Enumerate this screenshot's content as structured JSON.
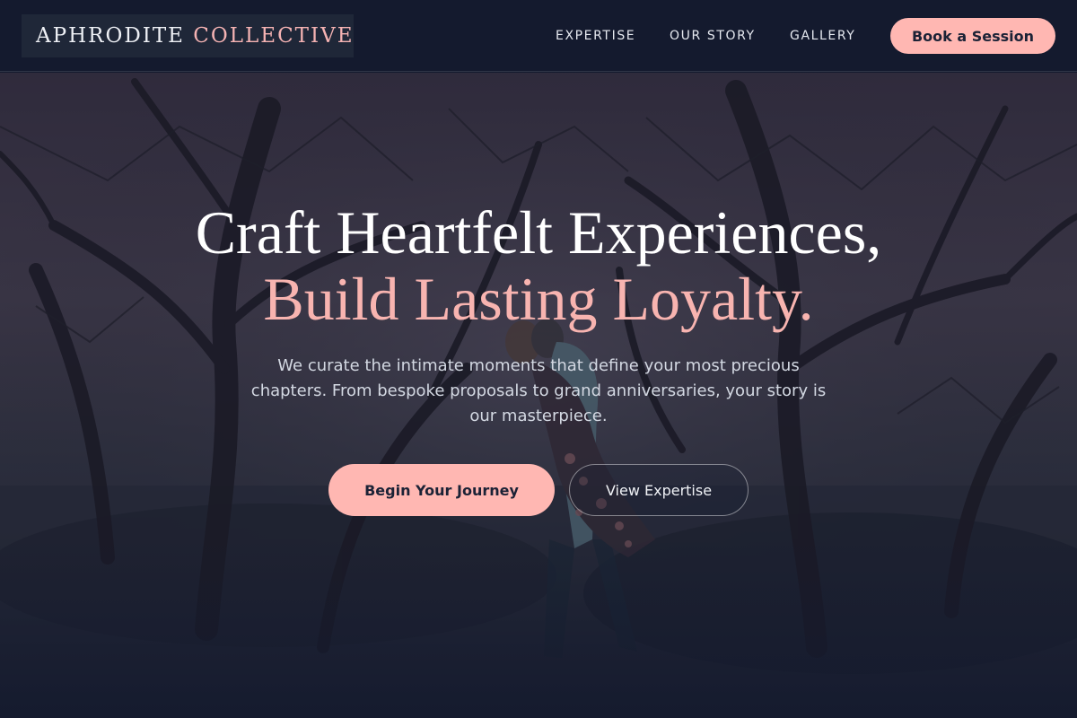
{
  "brand": {
    "name_part1": "APHRODITE",
    "name_part2": "COLLECTIVE"
  },
  "nav": {
    "links": [
      {
        "label": "EXPERTISE"
      },
      {
        "label": "OUR STORY"
      },
      {
        "label": "GALLERY"
      }
    ],
    "cta_label": "Book a Session"
  },
  "hero": {
    "headline_line1": "Craft Heartfelt Experiences,",
    "headline_line2": "Build Lasting Loyalty.",
    "subtext": "We curate the intimate moments that define your most precious chapters. From bespoke proposals to grand anniversaries, your story is our masterpiece.",
    "primary_button": "Begin Your Journey",
    "secondary_button": "View Expertise",
    "background_image": "couple-kissing-under-trees-photo"
  },
  "colors": {
    "background": "#141a2e",
    "accent_pink": "#ffb7b2",
    "headline_pink": "#f8b4b0",
    "text_light": "#ffffff",
    "text_muted": "#d3d8e2"
  }
}
